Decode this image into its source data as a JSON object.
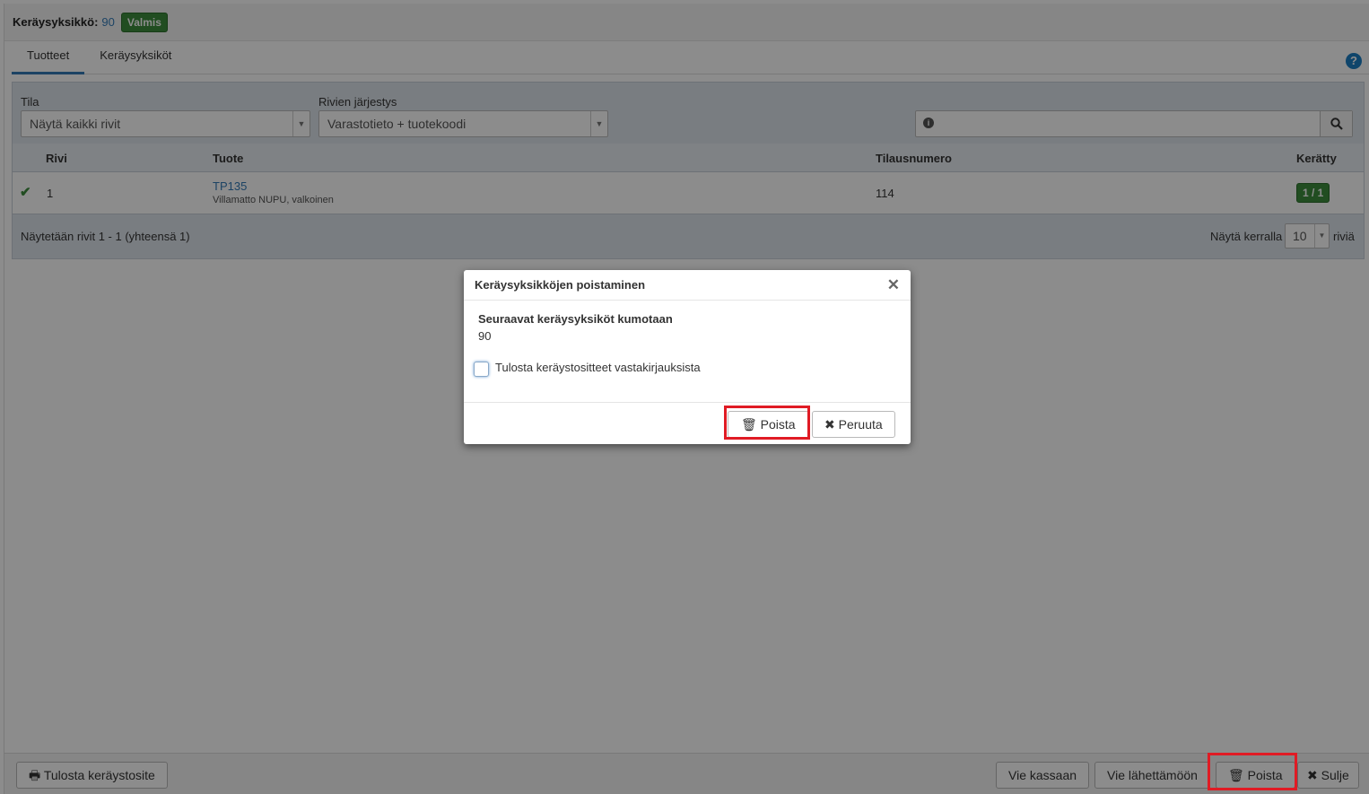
{
  "header": {
    "label": "Keräysyksikkö:",
    "number": "90",
    "status": "Valmis"
  },
  "tabs": [
    {
      "label": "Tuotteet",
      "active": true
    },
    {
      "label": "Keräysyksiköt",
      "active": false
    }
  ],
  "help_icon": "question-circle-icon",
  "filters": {
    "tila_label": "Tila",
    "tila_value": "Näytä kaikki rivit",
    "order_label": "Rivien järjestys",
    "order_value": "Varastotieto + tuotekoodi",
    "search_value": ""
  },
  "table": {
    "columns": [
      "Rivi",
      "Tuote",
      "Tilausnumero",
      "Kerätty"
    ],
    "rows": [
      {
        "rivi": "1",
        "product_code": "TP135",
        "product_name": "Villamatto NUPU, valkoinen",
        "order_number": "114",
        "collected": "1 / 1",
        "status_icon": "check-icon"
      }
    ],
    "footer_text": "Näytetään rivit 1 - 1 (yhteensä 1)",
    "page_size_label": "Näytä kerralla",
    "page_size": "10",
    "page_size_suffix": "riviä"
  },
  "bottom_bar": {
    "print_button": "Tulosta keräystosite",
    "to_checkout_button": "Vie kassaan",
    "to_shipping_button": "Vie lähettämöön",
    "delete_button": "Poista",
    "close_button": "Sulje"
  },
  "modal": {
    "title": "Keräysyksikköjen poistaminen",
    "message_heading": "Seuraavat keräysyksiköt kumotaan",
    "units": "90",
    "checkbox_label": "Tulosta keräystositteet vastakirjauksista",
    "checkbox_checked": false,
    "delete_button": "Poista",
    "cancel_button": "Peruuta"
  },
  "colors": {
    "accent": "#337ab7",
    "success": "#3c8d3c",
    "highlight": "#e01b24"
  }
}
